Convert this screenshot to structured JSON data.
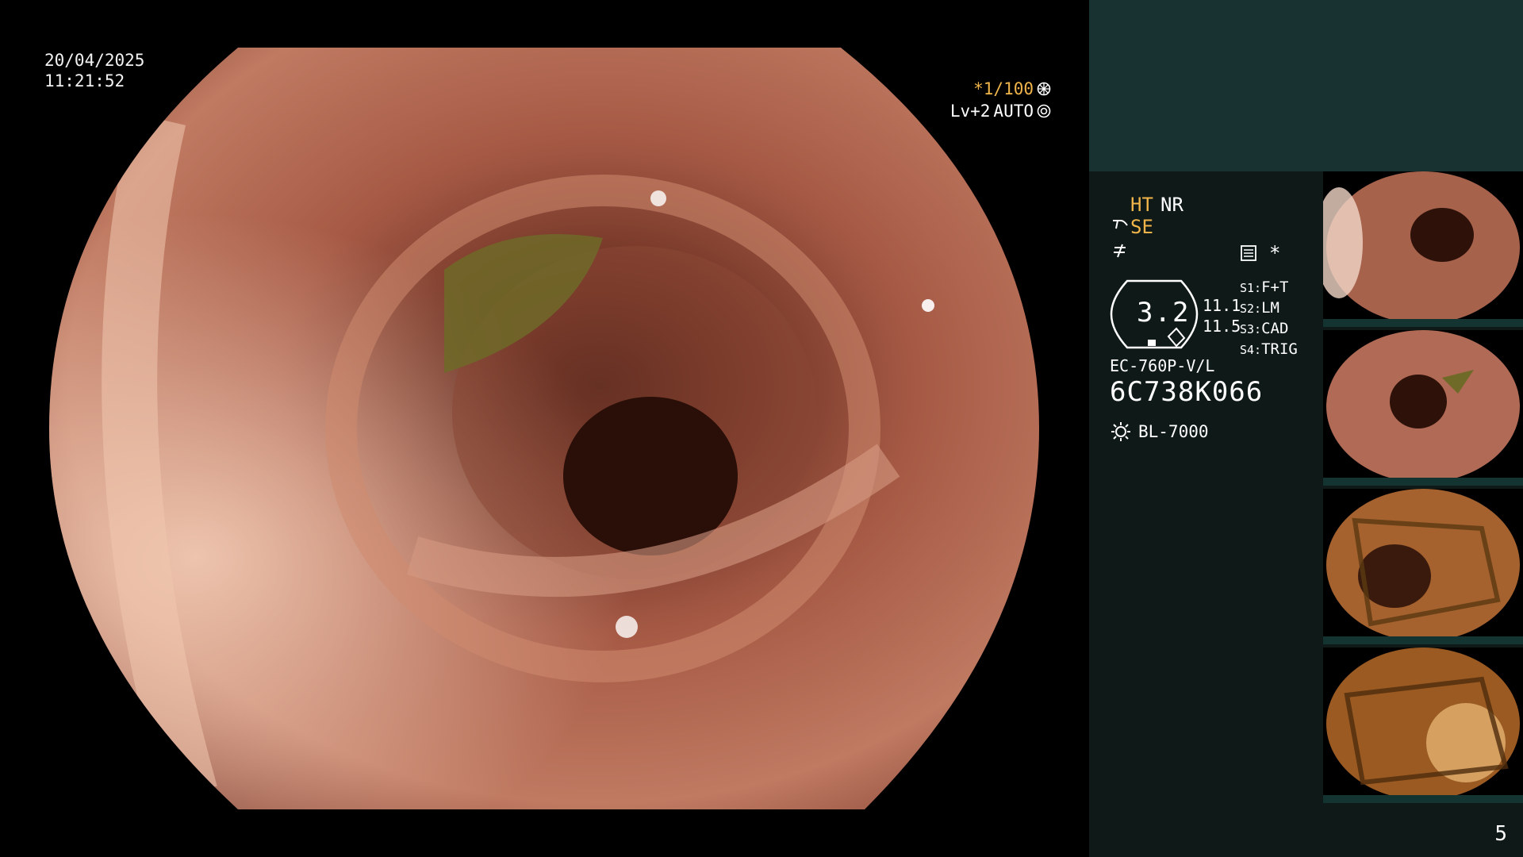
{
  "main": {
    "date": "20/04/2025",
    "time": "11:21:52",
    "shutter_value": "*1/100",
    "shutter_icon": "shutter-icon",
    "enhance_level": "Lv+2",
    "iris_mode": "AUTO",
    "iris_icon": "iris-icon"
  },
  "status": {
    "ht": "HT",
    "nr": "NR",
    "se": "SE",
    "mem_icon": "memory-icon",
    "star": "*",
    "zoom": "3.2",
    "num1": "11.1",
    "num2": "11.5",
    "switches": [
      {
        "key": "S1:",
        "value": "F+T"
      },
      {
        "key": "S2:",
        "value": "LM"
      },
      {
        "key": "S3:",
        "value": "CAD"
      },
      {
        "key": "S4:",
        "value": "TRIG"
      }
    ],
    "scope_model": "EC-760P-V/L",
    "scope_serial": "6C738K066",
    "light_source": "BL-7000",
    "light_icon": "light-source-icon"
  },
  "page_number": "5",
  "colors": {
    "accent_orange": "#f0b44a",
    "panel_dark": "#0f1a18",
    "panel_teal": "#173230",
    "thumb_bar": "#133430"
  }
}
